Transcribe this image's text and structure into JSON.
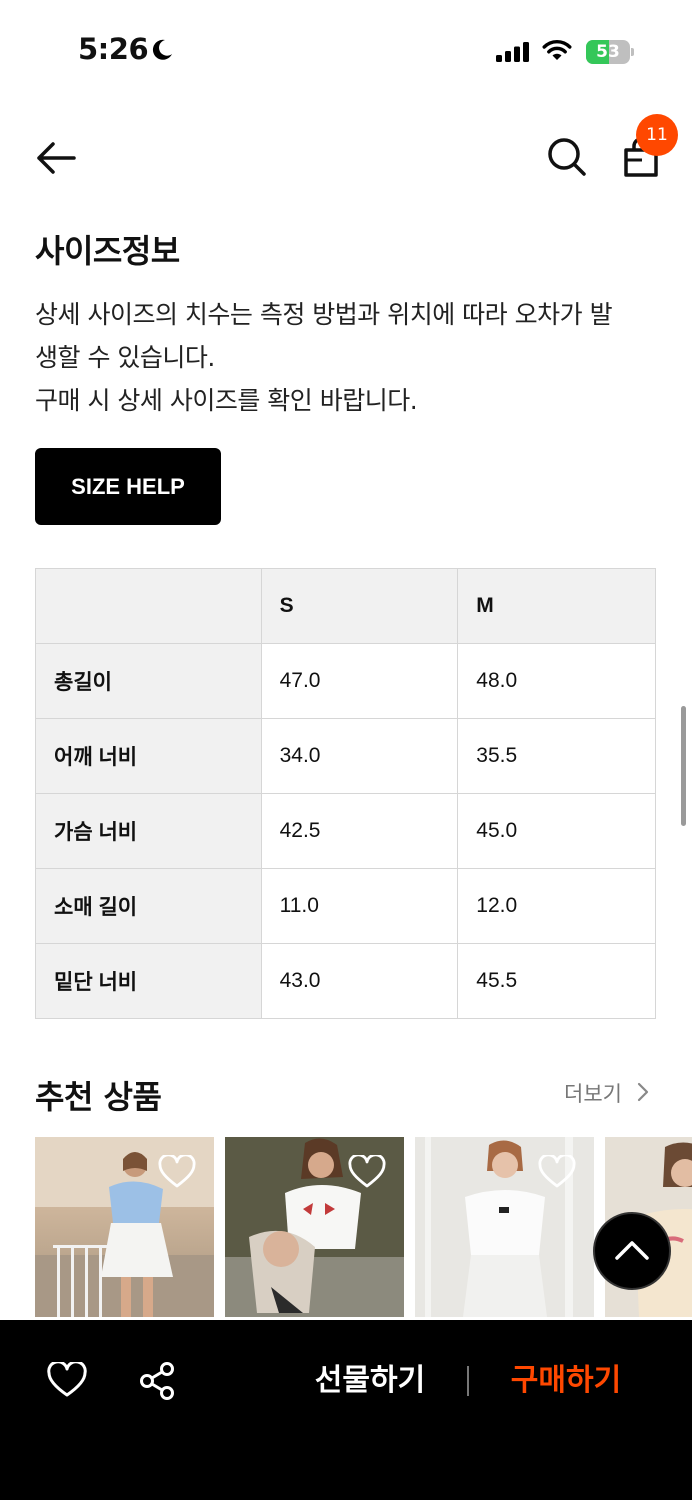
{
  "status_bar": {
    "time": "5:26",
    "battery_level": "53",
    "battery_fraction": 0.53
  },
  "header": {
    "cart_count": "11",
    "icons": [
      "back-arrow-icon",
      "search-icon",
      "shopping-bag-icon"
    ]
  },
  "size_info": {
    "title": "사이즈정보",
    "description_lines": [
      "상세 사이즈의 치수는 측정 방법과 위치에 따라 오차가 발",
      "생할 수 있습니다.",
      "구매 시 상세 사이즈를 확인 바랍니다."
    ],
    "help_button": "SIZE HELP",
    "table": {
      "headers": [
        "",
        "S",
        "M"
      ],
      "rows": [
        [
          "총길이",
          "47.0",
          "48.0"
        ],
        [
          "어깨 너비",
          "34.0",
          "35.5"
        ],
        [
          "가슴 너비",
          "42.5",
          "45.0"
        ],
        [
          "소매 길이",
          "11.0",
          "12.0"
        ],
        [
          "밑단 너비",
          "43.0",
          "45.5"
        ]
      ]
    }
  },
  "recommendations": {
    "title": "추천 상품",
    "more_label": "더보기",
    "products": [
      {
        "image": "woman-blue-top-white-skirt"
      },
      {
        "image": "woman-white-tee-red-bows"
      },
      {
        "image": "woman-white-top-white-skirt"
      },
      {
        "image": "woman-cream-tee-partial"
      }
    ]
  },
  "bottom_bar": {
    "gift_label": "선물하기",
    "buy_label": "구매하기",
    "buy_color": "#ff4800",
    "icons": [
      "heart-icon",
      "share-icon"
    ]
  },
  "colors": {
    "accent": "#ff4800",
    "table_header_bg": "#f1f1f1",
    "battery_green": "#34c759"
  }
}
